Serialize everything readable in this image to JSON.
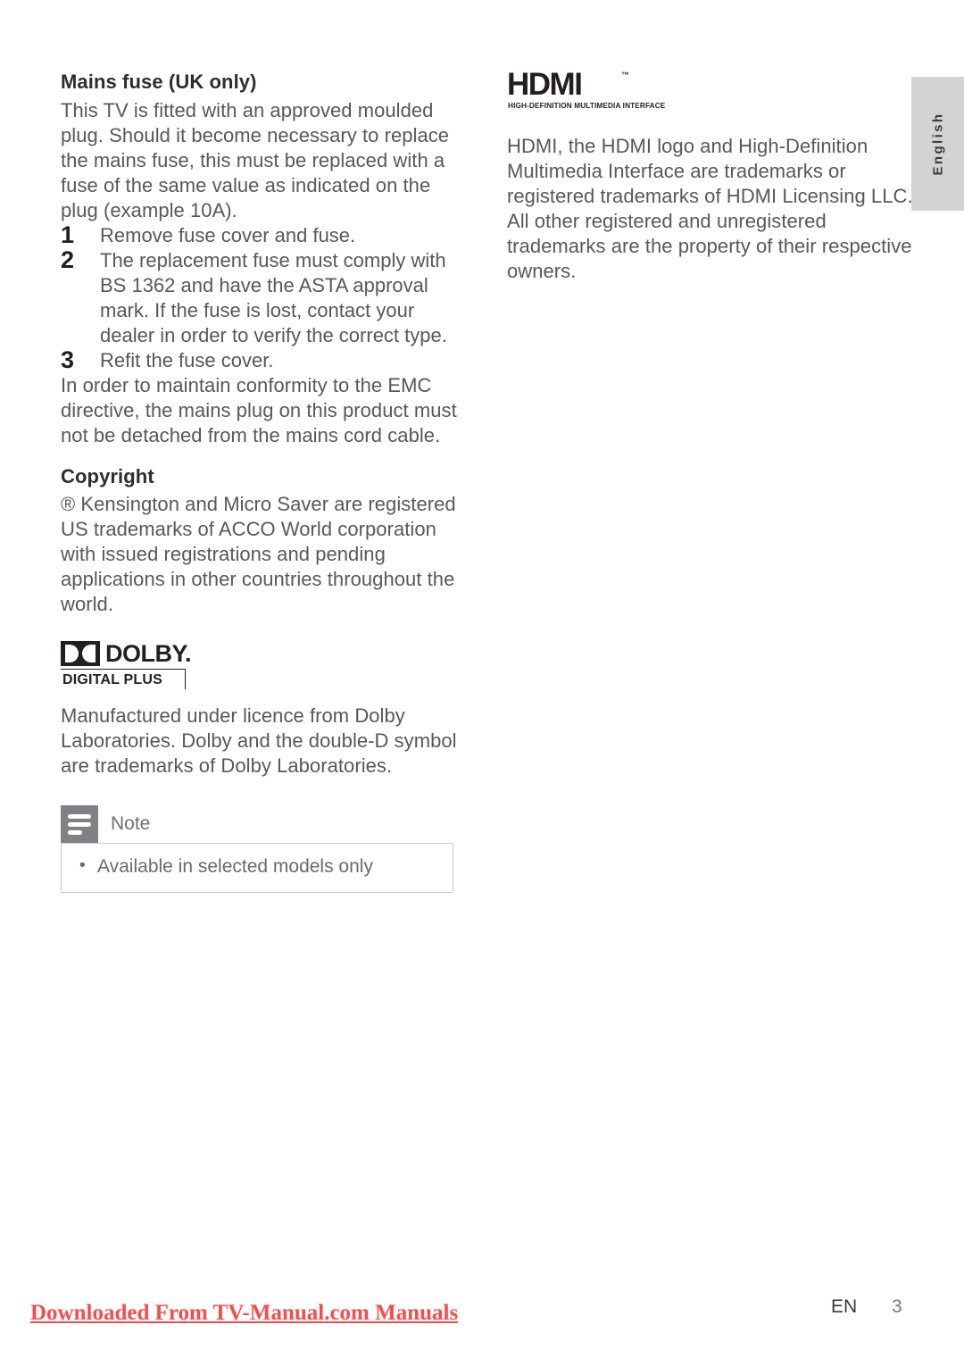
{
  "sidebar": {
    "language_tab": "English"
  },
  "left_column": {
    "mains_fuse": {
      "heading": "Mains fuse (UK only)",
      "intro": "This TV is fitted with an approved moulded plug. Should it become necessary to replace the mains fuse, this must be replaced with a fuse of the same value as indicated on the plug (example 10A).",
      "steps": [
        {
          "number": "1",
          "text": "Remove fuse cover and fuse."
        },
        {
          "number": "2",
          "text": "The replacement fuse must comply with BS 1362 and have the ASTA approval mark. If the fuse is lost, contact your dealer in order to verify the correct type."
        },
        {
          "number": "3",
          "text": "Refit the fuse cover."
        }
      ],
      "outro": "In order to maintain conformity to the EMC directive, the mains plug on this product must not be detached from the mains cord cable."
    },
    "copyright": {
      "heading": "Copyright",
      "text": "® Kensington and Micro Saver are registered US trademarks of ACCO World corporation with issued registrations and pending applications in other countries throughout the world."
    },
    "dolby": {
      "wordmark": "DOLBY.",
      "subtitle": "DIGITAL PLUS",
      "text": "Manufactured under licence from Dolby Laboratories. Dolby and the double-D symbol are trademarks of Dolby Laboratories."
    },
    "note": {
      "title": "Note",
      "items": [
        "Available in selected models only"
      ]
    }
  },
  "right_column": {
    "hdmi": {
      "wordmark": "HDMI",
      "trademark_symbol": "™",
      "tagline": "HIGH-DEFINITION MULTIMEDIA INTERFACE",
      "text": "HDMI, the HDMI logo and High-Definition Multimedia Interface are trademarks or registered trademarks of HDMI Licensing LLC. All other registered and unregistered trademarks are the property of their respective owners."
    }
  },
  "footer": {
    "download_link": "Downloaded From TV-Manual.com Manuals",
    "language_code": "EN",
    "page_number": "3"
  },
  "colors": {
    "body_text": "#58585a",
    "heading_text": "#2e2e30",
    "tab_background": "#d3d3d5",
    "note_icon": "#808085",
    "footer_link": "#fa4b4b",
    "logo_black": "#231f20"
  }
}
